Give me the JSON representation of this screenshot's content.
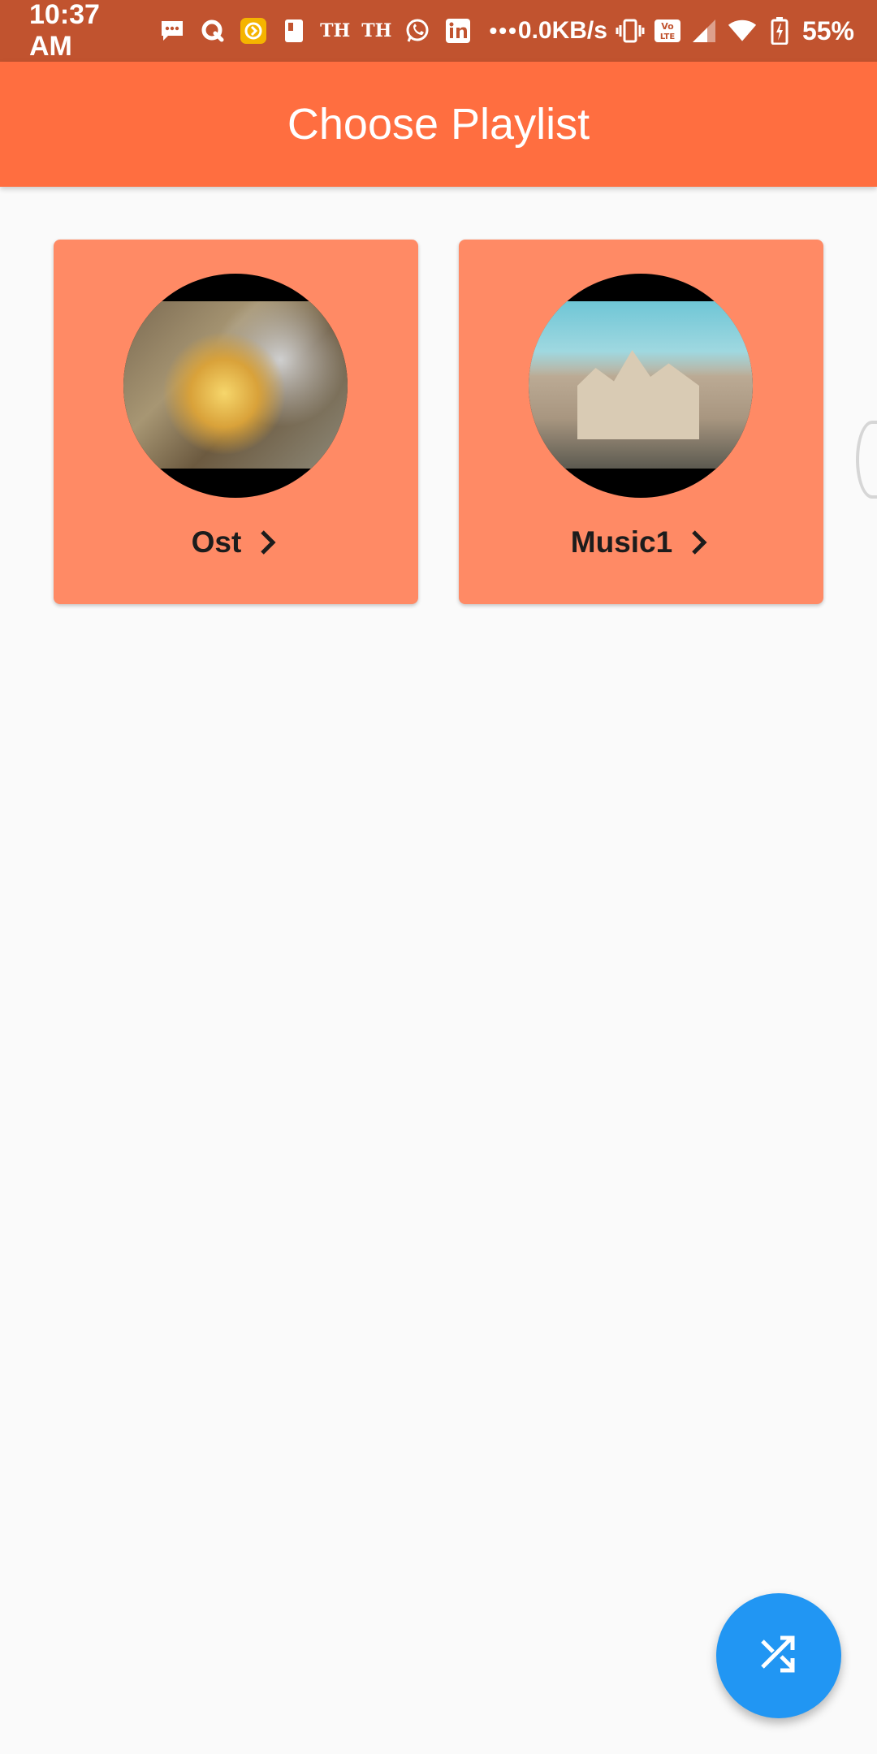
{
  "status_bar": {
    "time": "10:37 AM",
    "th_1": "TH",
    "th_2": "TH",
    "more": "•••",
    "net_speed": "0.0KB/s",
    "battery": "55%",
    "icons": [
      "message-icon",
      "q-app-icon",
      "yellow-app-icon",
      "file-icon",
      "whatsapp-icon",
      "linkedin-icon",
      "vibrate-icon",
      "volte-icon",
      "signal-icon",
      "wifi-icon",
      "battery-charging-icon"
    ]
  },
  "app_bar": {
    "title": "Choose Playlist",
    "color": "#ff6e40"
  },
  "playlists": [
    {
      "label": "Ost",
      "icon": "chevron-right-icon"
    },
    {
      "label": "Music1",
      "icon": "chevron-right-icon"
    }
  ],
  "card_color": "#ff8a65",
  "fab": {
    "icon": "shuffle-icon",
    "color": "#2196f3"
  }
}
